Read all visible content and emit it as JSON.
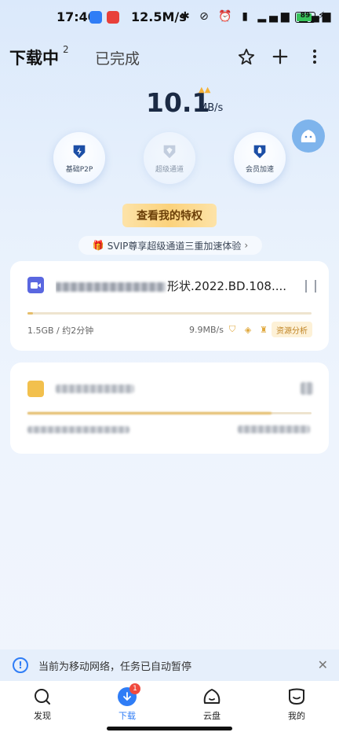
{
  "status_bar": {
    "time": "17:40",
    "net_speed": "12.5M/s",
    "battery": "89"
  },
  "tabs": {
    "downloading": "下载中",
    "downloading_count": "2",
    "completed": "已完成"
  },
  "speed": {
    "value": "10.1",
    "unit": "MB/s"
  },
  "features": [
    {
      "label": "基础P2P"
    },
    {
      "label": "超级通道"
    },
    {
      "label": "会员加速"
    }
  ],
  "privilege_button": "查看我的特权",
  "svip_promo": "SVIP尊享超级通道三重加速体验",
  "tasks": [
    {
      "name_visible": "形状.2022.BD.108....",
      "size_eta": "1.5GB / 约2分钟",
      "speed": "9.9MB/s",
      "analysis_label": "资源分析",
      "progress": 0.02
    },
    {
      "progress": 0.86
    }
  ],
  "notice": "当前为移动网络，任务已自动暂停",
  "nav": {
    "discover": "发现",
    "download": "下载",
    "download_badge": "1",
    "cloud": "云盘",
    "me": "我的"
  },
  "colors": {
    "accent": "#2f7df6",
    "gold": "#e6be6b"
  }
}
